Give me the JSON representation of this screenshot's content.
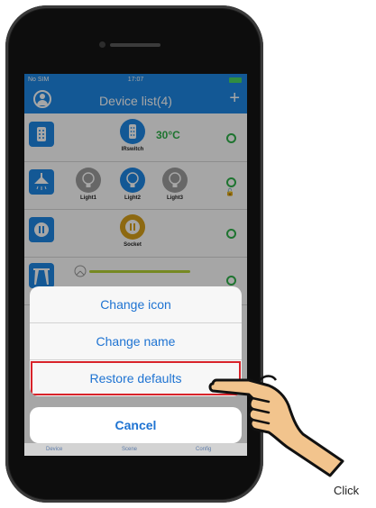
{
  "status_bar": {
    "carrier": "No SIM",
    "time": "17:07"
  },
  "nav": {
    "title": "Device list(4)",
    "add_label": "+"
  },
  "devices": {
    "ir": {
      "name": "IRswitch",
      "temperature": "30°C"
    },
    "lights": [
      {
        "name": "Light1"
      },
      {
        "name": "Light2"
      },
      {
        "name": "Light3"
      }
    ],
    "socket": {
      "name": "Socket"
    }
  },
  "action_sheet": {
    "options": [
      {
        "label": "Change icon"
      },
      {
        "label": "Change name"
      },
      {
        "label": "Restore defaults"
      }
    ],
    "cancel_label": "Cancel"
  },
  "tabbar": {
    "items": [
      {
        "label": "Device"
      },
      {
        "label": "Scene"
      },
      {
        "label": "Config"
      }
    ]
  },
  "annotation": {
    "text": "Click"
  },
  "colors": {
    "primary": "#1e88e5",
    "highlight": "#d8232a",
    "accent_green": "#2fb34a",
    "socket_orange": "#d9a21b"
  }
}
